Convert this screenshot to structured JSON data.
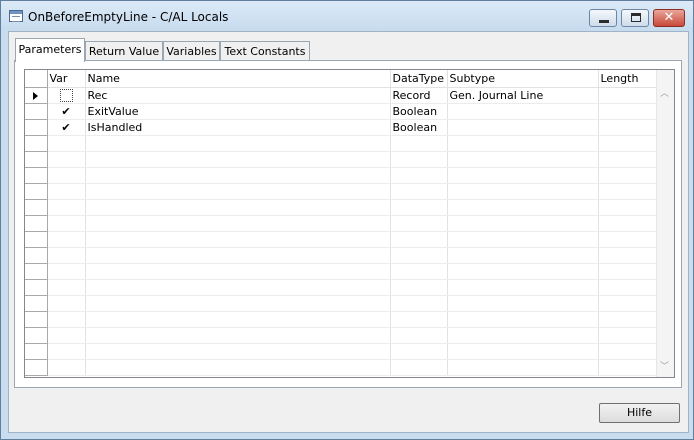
{
  "window": {
    "title": "OnBeforeEmptyLine - C/AL Locals"
  },
  "tabs": [
    {
      "label": "Parameters"
    },
    {
      "label": "Return Value"
    },
    {
      "label": "Variables"
    },
    {
      "label": "Text Constants"
    }
  ],
  "grid": {
    "columns": {
      "var": "Var",
      "name": "Name",
      "datatype": "DataType",
      "subtype": "Subtype",
      "length": "Length"
    },
    "rows": [
      {
        "var": "",
        "name": "Rec",
        "datatype": "Record",
        "subtype": "Gen. Journal Line",
        "length": ""
      },
      {
        "var": "✔",
        "name": "ExitValue",
        "datatype": "Boolean",
        "subtype": "",
        "length": ""
      },
      {
        "var": "✔",
        "name": "IsHandled",
        "datatype": "Boolean",
        "subtype": "",
        "length": ""
      }
    ],
    "empty_row_count": 15
  },
  "buttons": {
    "help": "Hilfe"
  },
  "icons": {
    "app": "table-window-icon",
    "minimize": "minimize-icon",
    "maximize": "maximize-icon",
    "close": "close-icon",
    "row_pointer": "row-pointer-icon",
    "scroll_up": "scroll-up-arrow-icon",
    "scroll_down": "scroll-down-arrow-icon"
  }
}
